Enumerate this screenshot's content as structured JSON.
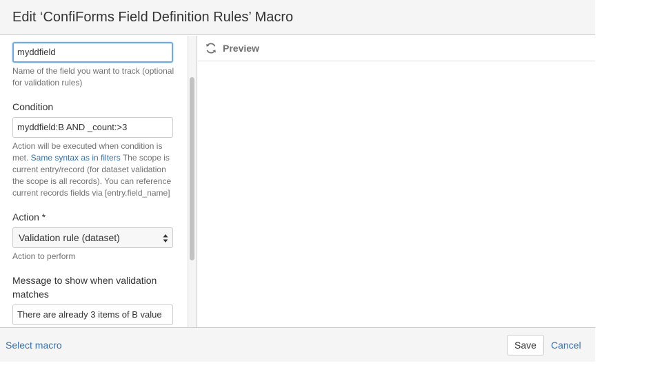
{
  "dialog": {
    "title": "Edit ‘ConfiForms Field Definition Rules’ Macro"
  },
  "form": {
    "field_name": {
      "value": "myddfield",
      "help": "Name of the field you want to track (optional for validation rules)"
    },
    "condition": {
      "label": "Condition",
      "value": "myddfield:B AND  _count:>3",
      "help_before": "Action will be executed when condition is met. ",
      "help_link": "Same syntax as in filters",
      "help_after": " The scope is current entry/record (for dataset validation the scope is all records). You can reference current records fields via [entry.field_name]"
    },
    "action": {
      "label": "Action *",
      "selected": "Validation rule (dataset)",
      "help": "Action to perform"
    },
    "message": {
      "label": "Message to show when validation matches",
      "value": "There are already 3 items of B value"
    }
  },
  "preview": {
    "label": "Preview",
    "icon": "refresh-icon"
  },
  "footer": {
    "select_macro": "Select macro",
    "save": "Save",
    "cancel": "Cancel"
  },
  "colors": {
    "link": "#3572b0",
    "focus_border": "#6fa9e6",
    "header_bg": "#f5f5f5"
  }
}
